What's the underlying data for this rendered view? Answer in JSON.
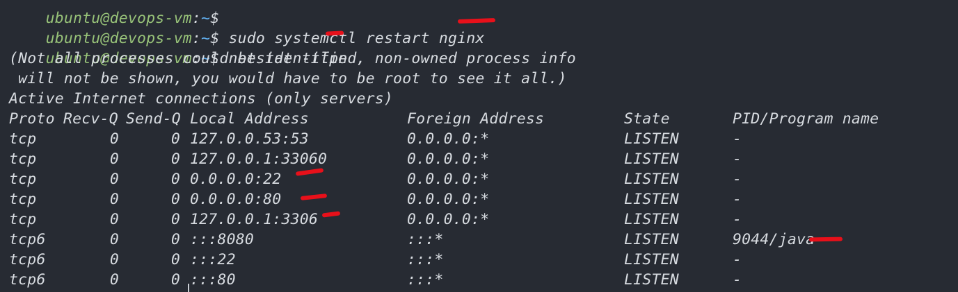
{
  "terminal": {
    "top_line": {
      "user": "ubuntu@devops-vm",
      "sep": ":",
      "path": "~",
      "dollar": "$"
    },
    "prompt1": {
      "user": "ubuntu@devops-vm",
      "sep": ":",
      "path": "~",
      "dollar": "$",
      "command": " sudo systemctl restart nginx"
    },
    "prompt2": {
      "user": "ubuntu@devops-vm",
      "sep": ":",
      "path": "~",
      "dollar": "$",
      "command": " netstat -tlpn"
    },
    "note1": "(Not all processes could be identified, non-owned process info",
    "note2": " will not be shown, you would have to be root to see it all.)",
    "heading": "Active Internet connections (only servers)",
    "columns": {
      "proto": "Proto",
      "recv": "Recv-Q",
      "send": "Send-Q",
      "local": "Local Address",
      "foreign": "Foreign Address",
      "state": "State",
      "pid": "PID/Program name"
    },
    "rows": [
      {
        "proto": "tcp",
        "recv": "0",
        "send": "0",
        "local": "127.0.0.53:53",
        "foreign": "0.0.0.0:*",
        "state": "LISTEN",
        "pid": "-"
      },
      {
        "proto": "tcp",
        "recv": "0",
        "send": "0",
        "local": "127.0.0.1:33060",
        "foreign": "0.0.0.0:*",
        "state": "LISTEN",
        "pid": "-"
      },
      {
        "proto": "tcp",
        "recv": "0",
        "send": "0",
        "local": "0.0.0.0:22",
        "foreign": "0.0.0.0:*",
        "state": "LISTEN",
        "pid": "-"
      },
      {
        "proto": "tcp",
        "recv": "0",
        "send": "0",
        "local": "0.0.0.0:80",
        "foreign": "0.0.0.0:*",
        "state": "LISTEN",
        "pid": "-"
      },
      {
        "proto": "tcp",
        "recv": "0",
        "send": "0",
        "local": "127.0.0.1:3306",
        "foreign": "0.0.0.0:*",
        "state": "LISTEN",
        "pid": "-"
      },
      {
        "proto": "tcp6",
        "recv": "0",
        "send": "0",
        "local": ":::8080",
        "foreign": ":::*",
        "state": "LISTEN",
        "pid": "9044/java"
      },
      {
        "proto": "tcp6",
        "recv": "0",
        "send": "0",
        "local": ":::22",
        "foreign": ":::*",
        "state": "LISTEN",
        "pid": "-"
      },
      {
        "proto": "tcp6",
        "recv": "0",
        "send": "0",
        "local": ":::80",
        "foreign": ":::*",
        "state": "LISTEN",
        "pid": "-"
      }
    ],
    "colors": {
      "background": "#272b33",
      "text": "#d7dbe0",
      "user": "#98c379",
      "path": "#61afef",
      "annotation": "#e8101a"
    }
  }
}
